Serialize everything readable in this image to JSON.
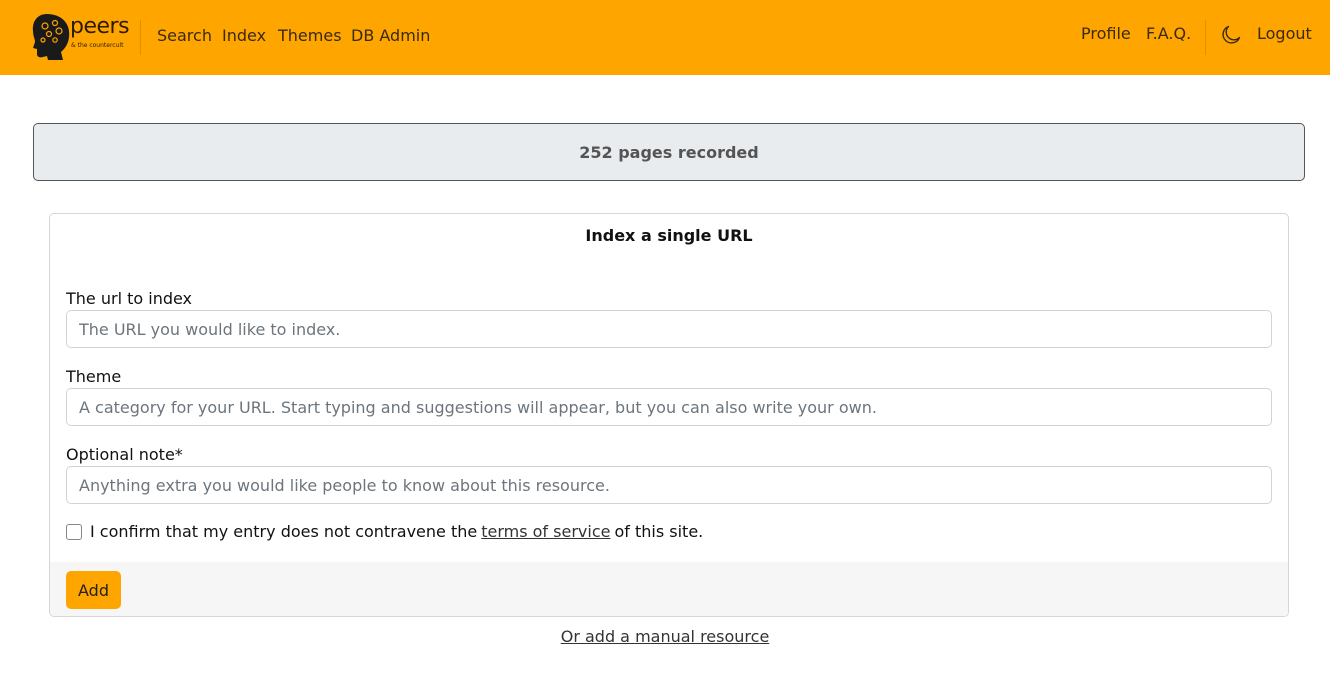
{
  "brand": {
    "name": "peers",
    "tagline": "& the countercult"
  },
  "nav": {
    "left": [
      "Search",
      "Index",
      "Themes",
      "DB Admin"
    ],
    "right": [
      "Profile",
      "F.A.Q."
    ],
    "logout": "Logout",
    "theme_toggle_icon": "moon-icon"
  },
  "stats": {
    "text": "252 pages recorded"
  },
  "form": {
    "title": "Index a single URL",
    "url": {
      "label": "The url to index",
      "placeholder": "The URL you would like to index."
    },
    "theme": {
      "label": "Theme",
      "placeholder": "A category for your URL. Start typing and suggestions will appear, but you can also write your own."
    },
    "note": {
      "label": "Optional note*",
      "placeholder": "Anything extra you would like people to know about this resource."
    },
    "confirm": {
      "before": "I confirm that my entry does not contravene the",
      "link": "terms of service",
      "after": "of this site."
    },
    "submit": "Add"
  },
  "manual_link": "Or add a manual resource",
  "colors": {
    "accent": "#ffa500",
    "stats_bg": "#e9ecef",
    "footer_bg": "#f6f6f6"
  }
}
